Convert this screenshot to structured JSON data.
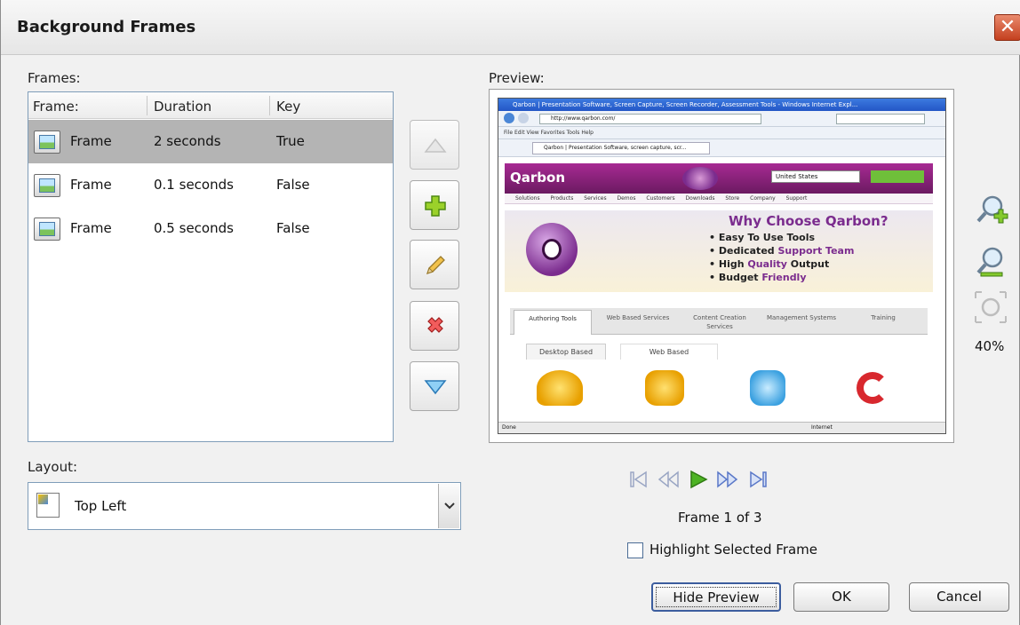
{
  "window": {
    "title": "Background Frames",
    "close_glyph": "✕"
  },
  "frames": {
    "label": "Frames:",
    "columns": [
      "Frame:",
      "Duration",
      "Key"
    ],
    "rows": [
      {
        "name": "Frame",
        "duration": "2 seconds",
        "key": "True",
        "selected": true
      },
      {
        "name": "Frame",
        "duration": "0.1 seconds",
        "key": "False",
        "selected": false
      },
      {
        "name": "Frame",
        "duration": "0.5 seconds",
        "key": "False",
        "selected": false
      }
    ]
  },
  "side_buttons": {
    "move_up": {
      "icon": "move-up-icon",
      "enabled": false
    },
    "add": {
      "icon": "add-icon",
      "enabled": true
    },
    "edit": {
      "icon": "pencil-icon",
      "enabled": true
    },
    "delete": {
      "icon": "delete-icon",
      "enabled": true
    },
    "move_down": {
      "icon": "move-down-icon",
      "enabled": true
    }
  },
  "layout": {
    "label": "Layout:",
    "value": "Top Left"
  },
  "preview": {
    "label": "Preview:",
    "zoom_level": "40%",
    "frame_counter": "Frame 1 of 3",
    "screenshot": {
      "window_title": "Qarbon | Presentation Software, Screen Capture, Screen Recorder, Assessment Tools - Windows Internet Expl...",
      "address": "http://www.qarbon.com/",
      "tab": "Qarbon | Presentation Software, screen capture, scr...",
      "logo": "Qarbon",
      "country": "United States",
      "nav": "Solutions Products Services Demos Customers Downloads Store Company Support",
      "hero_title": "Why Choose Qarbon?",
      "hero_items": [
        [
          "Easy To Use Tools",
          ""
        ],
        [
          "Dedicated ",
          "Support Team"
        ],
        [
          "High ",
          "Quality",
          " Output"
        ],
        [
          "Budget ",
          "Friendly"
        ]
      ],
      "tabs": [
        "Authoring Tools",
        "Web Based Services",
        "Content Creation Services",
        "Management Systems",
        "Training"
      ],
      "subtabs": [
        "Desktop Based",
        "Web Based"
      ],
      "status": "Done",
      "status_right": "Internet"
    }
  },
  "options": {
    "highlight_selected_frame": "Highlight Selected Frame",
    "highlight_checked": false
  },
  "buttons": {
    "hide_preview": "Hide Preview",
    "ok": "OK",
    "cancel": "Cancel"
  },
  "colors": {
    "selection": "#b4b4b4",
    "accent_purple": "#7b2c8e",
    "play_green": "#4db324",
    "nav_disabled": "#9aa6c4"
  }
}
